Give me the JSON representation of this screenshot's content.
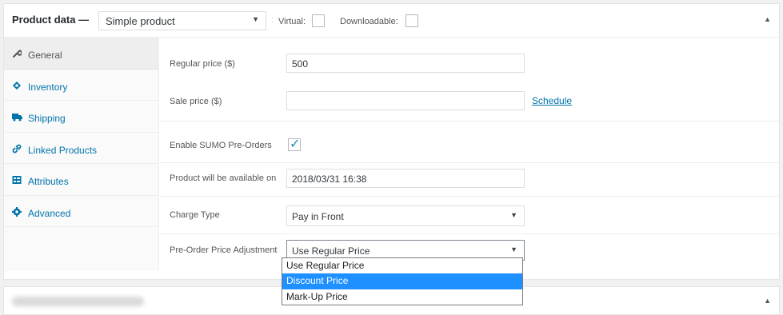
{
  "header": {
    "title": "Product data —",
    "product_type": "Simple product",
    "separator": ":",
    "virtual_label": "Virtual:",
    "downloadable_label": "Downloadable:",
    "virtual_checked": false,
    "downloadable_checked": false,
    "toggle_icon": "collapse-arrow-up-icon"
  },
  "tabs": [
    {
      "label": "General",
      "icon": "wrench-icon",
      "active": true
    },
    {
      "label": "Inventory",
      "icon": "inventory-icon",
      "active": false
    },
    {
      "label": "Shipping",
      "icon": "truck-icon",
      "active": false
    },
    {
      "label": "Linked Products",
      "icon": "link-icon",
      "active": false
    },
    {
      "label": "Attributes",
      "icon": "attributes-icon",
      "active": false
    },
    {
      "label": "Advanced",
      "icon": "gear-icon",
      "active": false
    }
  ],
  "general": {
    "regular_price_label": "Regular price ($)",
    "regular_price_value": "500",
    "sale_price_label": "Sale price ($)",
    "sale_price_value": "",
    "schedule_link": "Schedule",
    "enable_preorders_label": "Enable SUMO Pre-Orders",
    "enable_preorders_checked": true,
    "available_on_label": "Product will be available on",
    "available_on_value": "2018/03/31 16:38",
    "charge_type_label": "Charge Type",
    "charge_type_value": "Pay in Front",
    "price_adjustment_label": "Pre-Order Price Adjustment",
    "price_adjustment_value": "Use Regular Price",
    "price_adjustment_options": [
      "Use Regular Price",
      "Discount Price",
      "Mark-Up Price"
    ],
    "price_adjustment_highlighted": "Discount Price"
  },
  "colors": {
    "link": "#0073aa",
    "highlight": "#1e90ff",
    "checkmark": "#1e8cbe"
  }
}
